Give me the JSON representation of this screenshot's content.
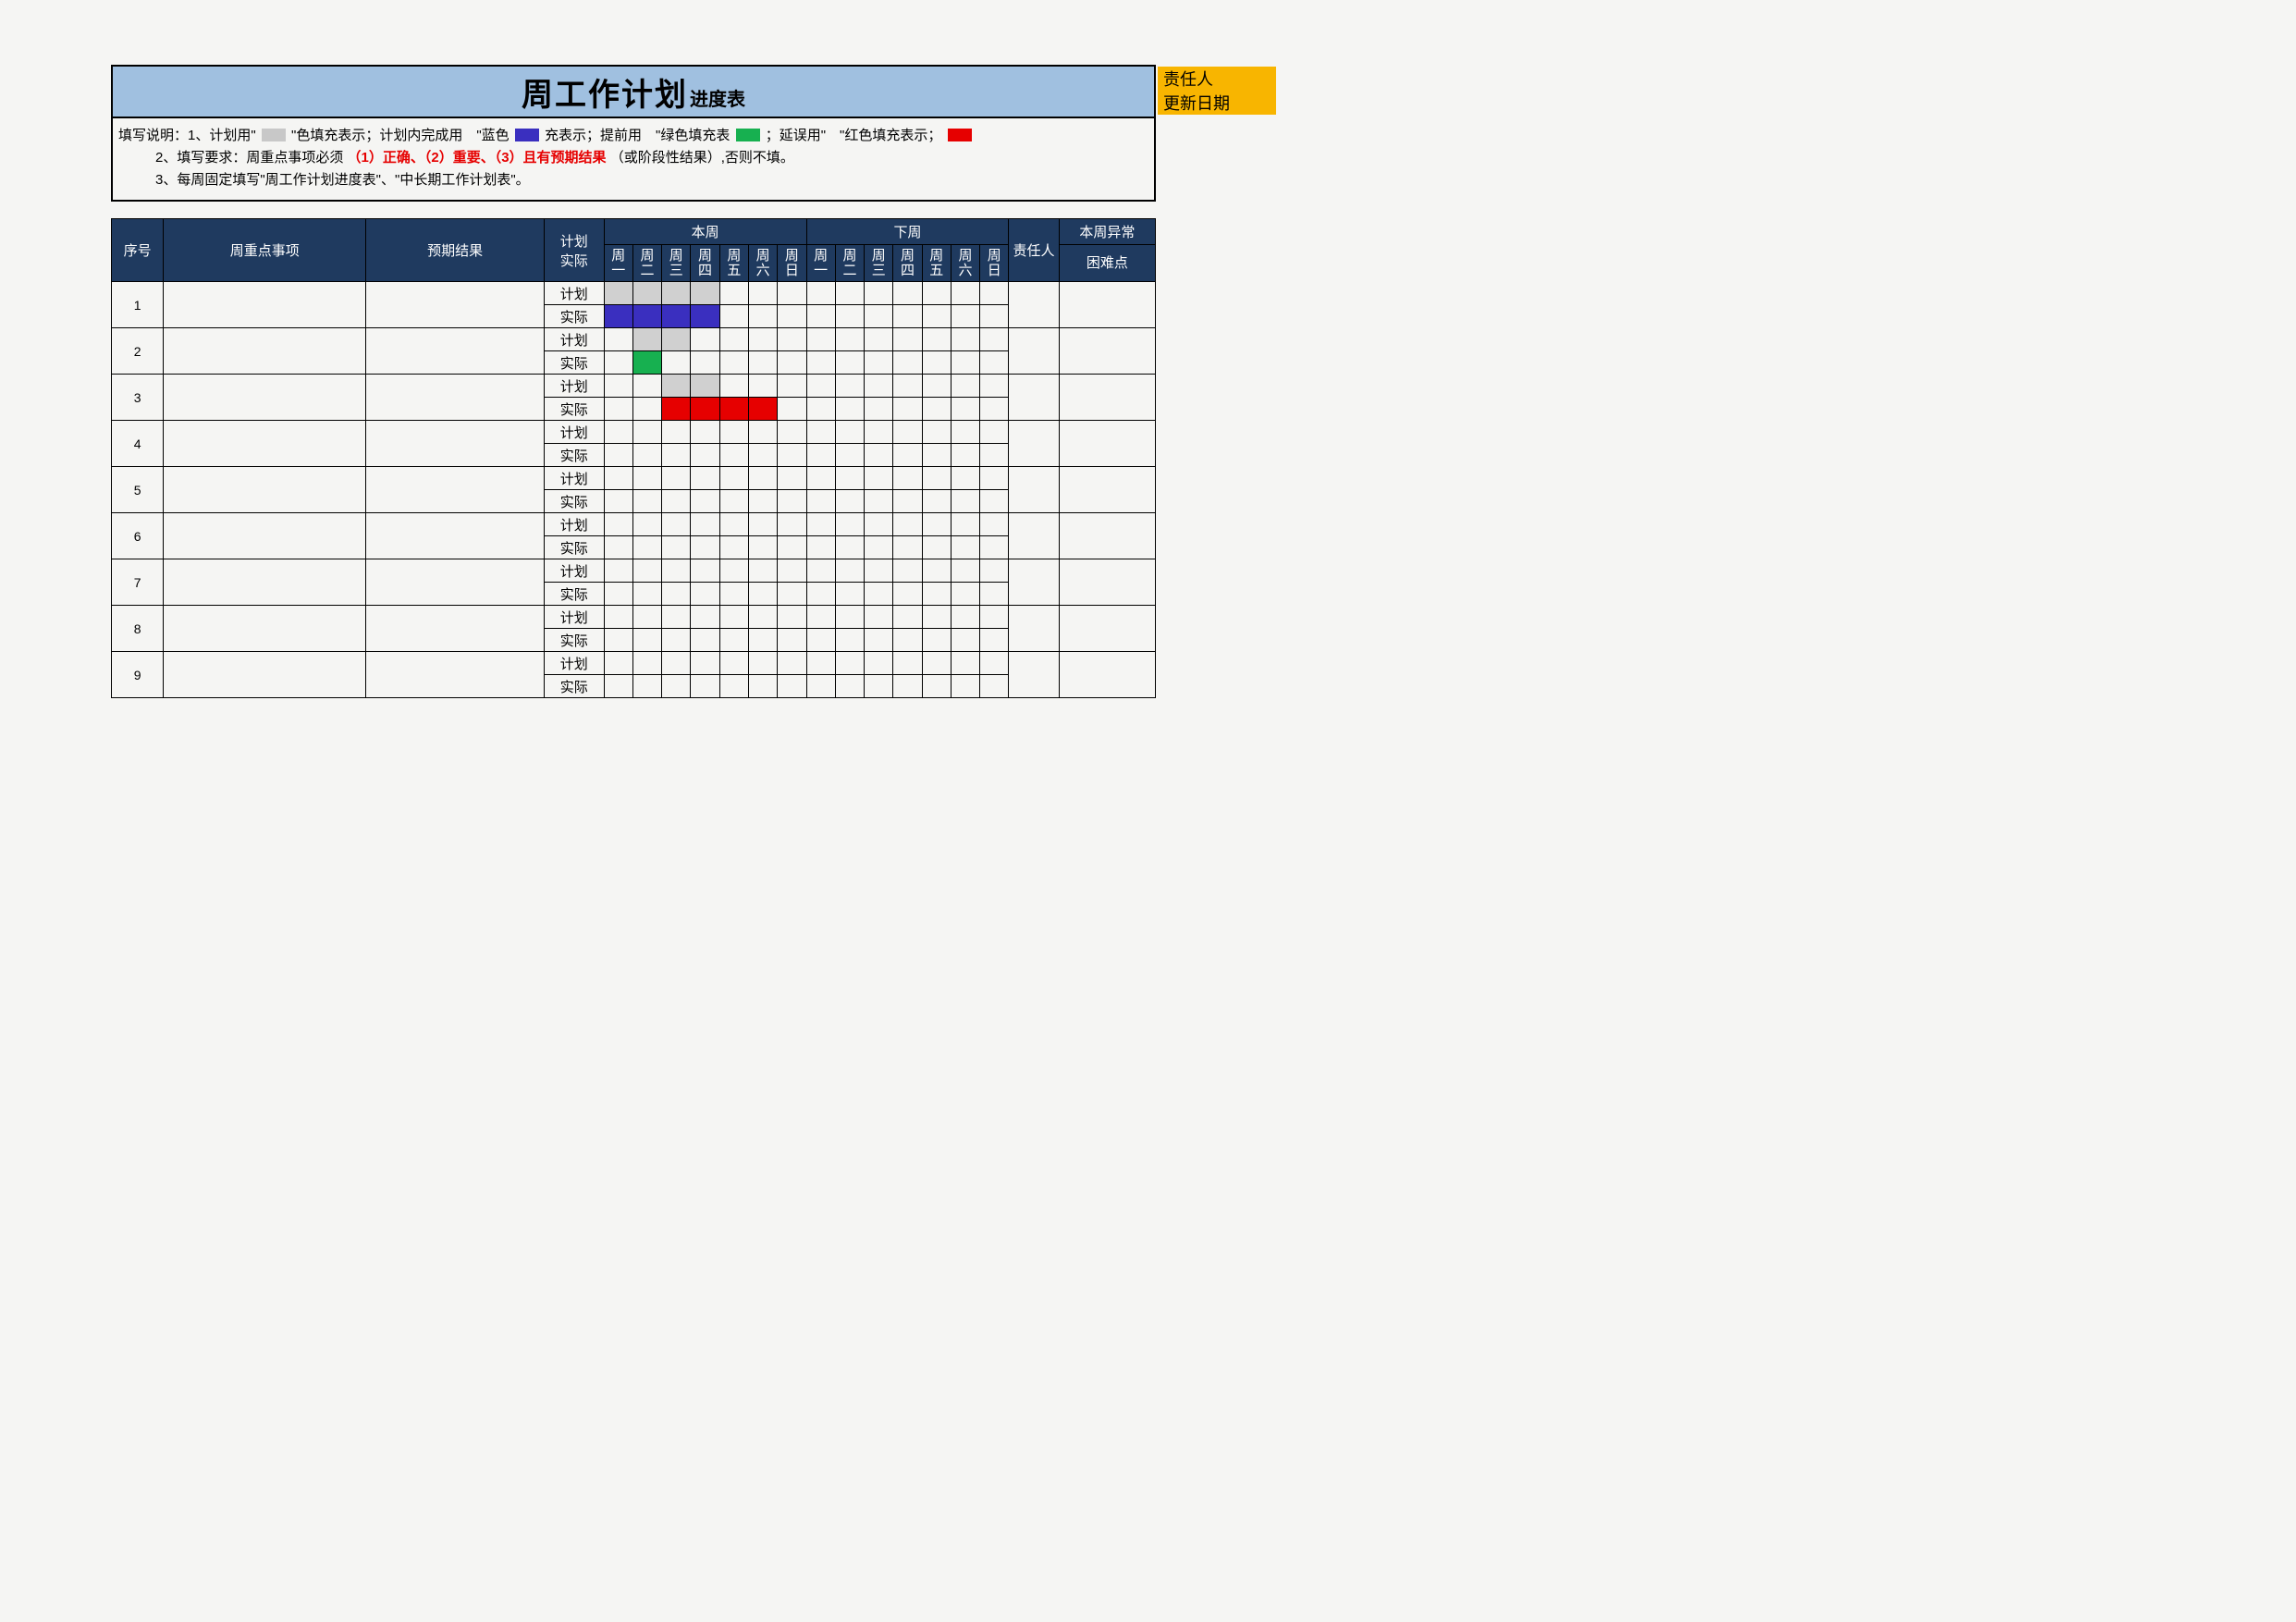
{
  "title_main": "周工作计划",
  "title_sub": "进度表",
  "side_tags": {
    "owner": "责任人",
    "update": "更新日期"
  },
  "legend": {
    "prefix": "填写说明：1、计划用\"",
    "grey_label": "\"色填充表示；计划内完成用 \"蓝色",
    "blue_tail": "充表示；提前用 \"绿色填充表",
    "green_tail": "；延误用\" \"红色填充表示；",
    "red_tail": ""
  },
  "note2_a": "2、填写要求：周重点事项必须",
  "note2_b": "（1）正确、（2）重要、（3）且有预期结果",
  "note2_c": "（或阶段性结果）,否则不填。",
  "note3": "3、每周固定填写\"周工作计划进度表\"、\"中长期工作计划表\"。",
  "headers": {
    "no": "序号",
    "item": "周重点事项",
    "expect": "预期结果",
    "plan_actual": "计划\n实际",
    "this_week": "本周",
    "next_week": "下周",
    "owner": "责任人",
    "exception": "本周异常",
    "difficulty": "困难点",
    "days": [
      "周\n一",
      "周\n二",
      "周\n三",
      "周\n四",
      "周\n五",
      "周\n六",
      "周\n日"
    ]
  },
  "plan_label": "计划",
  "actual_label": "实际",
  "rows": [
    {
      "no": "1",
      "item": "",
      "expect": "",
      "owner": "",
      "exception": "",
      "plan_fill": [
        "grey",
        "grey",
        "grey",
        "grey",
        "",
        "",
        "",
        "",
        "",
        "",
        "",
        "",
        "",
        ""
      ],
      "actual_fill": [
        "blue",
        "blue",
        "blue",
        "blue",
        "",
        "",
        "",
        "",
        "",
        "",
        "",
        "",
        "",
        ""
      ]
    },
    {
      "no": "2",
      "item": "",
      "expect": "",
      "owner": "",
      "exception": "",
      "plan_fill": [
        "",
        "grey",
        "grey",
        "",
        "",
        "",
        "",
        "",
        "",
        "",
        "",
        "",
        "",
        ""
      ],
      "actual_fill": [
        "",
        "green",
        "",
        "",
        "",
        "",
        "",
        "",
        "",
        "",
        "",
        "",
        "",
        ""
      ]
    },
    {
      "no": "3",
      "item": "",
      "expect": "",
      "owner": "",
      "exception": "",
      "plan_fill": [
        "",
        "",
        "grey",
        "grey",
        "",
        "",
        "",
        "",
        "",
        "",
        "",
        "",
        "",
        ""
      ],
      "actual_fill": [
        "",
        "",
        "red",
        "red",
        "red",
        "red",
        "",
        "",
        "",
        "",
        "",
        "",
        "",
        ""
      ]
    },
    {
      "no": "4",
      "item": "",
      "expect": "",
      "owner": "",
      "exception": "",
      "plan_fill": [
        "",
        "",
        "",
        "",
        "",
        "",
        "",
        "",
        "",
        "",
        "",
        "",
        "",
        ""
      ],
      "actual_fill": [
        "",
        "",
        "",
        "",
        "",
        "",
        "",
        "",
        "",
        "",
        "",
        "",
        "",
        ""
      ]
    },
    {
      "no": "5",
      "item": "",
      "expect": "",
      "owner": "",
      "exception": "",
      "plan_fill": [
        "",
        "",
        "",
        "",
        "",
        "",
        "",
        "",
        "",
        "",
        "",
        "",
        "",
        ""
      ],
      "actual_fill": [
        "",
        "",
        "",
        "",
        "",
        "",
        "",
        "",
        "",
        "",
        "",
        "",
        "",
        ""
      ]
    },
    {
      "no": "6",
      "item": "",
      "expect": "",
      "owner": "",
      "exception": "",
      "plan_fill": [
        "",
        "",
        "",
        "",
        "",
        "",
        "",
        "",
        "",
        "",
        "",
        "",
        "",
        ""
      ],
      "actual_fill": [
        "",
        "",
        "",
        "",
        "",
        "",
        "",
        "",
        "",
        "",
        "",
        "",
        "",
        ""
      ]
    },
    {
      "no": "7",
      "item": "",
      "expect": "",
      "owner": "",
      "exception": "",
      "plan_fill": [
        "",
        "",
        "",
        "",
        "",
        "",
        "",
        "",
        "",
        "",
        "",
        "",
        "",
        ""
      ],
      "actual_fill": [
        "",
        "",
        "",
        "",
        "",
        "",
        "",
        "",
        "",
        "",
        "",
        "",
        "",
        ""
      ]
    },
    {
      "no": "8",
      "item": "",
      "expect": "",
      "owner": "",
      "exception": "",
      "plan_fill": [
        "",
        "",
        "",
        "",
        "",
        "",
        "",
        "",
        "",
        "",
        "",
        "",
        "",
        ""
      ],
      "actual_fill": [
        "",
        "",
        "",
        "",
        "",
        "",
        "",
        "",
        "",
        "",
        "",
        "",
        "",
        ""
      ]
    },
    {
      "no": "9",
      "item": "",
      "expect": "",
      "owner": "",
      "exception": "",
      "plan_fill": [
        "",
        "",
        "",
        "",
        "",
        "",
        "",
        "",
        "",
        "",
        "",
        "",
        "",
        ""
      ],
      "actual_fill": [
        "",
        "",
        "",
        "",
        "",
        "",
        "",
        "",
        "",
        "",
        "",
        "",
        "",
        ""
      ]
    }
  ]
}
